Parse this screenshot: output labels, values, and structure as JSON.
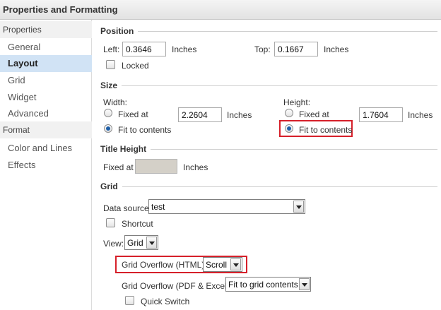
{
  "window": {
    "title": "Properties and Formatting"
  },
  "sidebar": {
    "groups": [
      {
        "label": "Properties"
      },
      {
        "label": "Format"
      }
    ],
    "items": [
      {
        "label": "General"
      },
      {
        "label": "Layout",
        "active": true
      },
      {
        "label": "Grid"
      },
      {
        "label": "Widget"
      },
      {
        "label": "Advanced"
      },
      {
        "label": "Color and Lines"
      },
      {
        "label": "Effects"
      }
    ]
  },
  "position": {
    "title": "Position",
    "left_label": "Left:",
    "left_value": "0.3646",
    "left_unit": "Inches",
    "top_label": "Top:",
    "top_value": "0.1667",
    "top_unit": "Inches",
    "locked_label": "Locked",
    "locked_checked": false
  },
  "size": {
    "title": "Size",
    "width_label": "Width:",
    "width_fixed_label": "Fixed at",
    "width_value": "2.2604",
    "width_unit": "Inches",
    "width_fit_label": "Fit to contents",
    "width_mode": "fit",
    "height_label": "Height:",
    "height_fixed_label": "Fixed at",
    "height_value": "1.7604",
    "height_unit": "Inches",
    "height_fit_label": "Fit to contents",
    "height_mode": "fit"
  },
  "title_height": {
    "title": "Title Height",
    "fixed_label": "Fixed at",
    "value": "",
    "unit": "Inches"
  },
  "grid": {
    "title": "Grid",
    "data_source_label": "Data source:",
    "data_source_value": "test",
    "shortcut_label": "Shortcut",
    "shortcut_checked": false,
    "view_label": "View:",
    "view_value": "Grid",
    "overflow_html_label": "Grid Overflow (HTML):",
    "overflow_html_value": "Scroll",
    "overflow_pdf_label": "Grid Overflow (PDF & Excel):",
    "overflow_pdf_value": "Fit to grid contents",
    "quick_switch_label": "Quick Switch",
    "quick_switch_checked": false
  },
  "colors": {
    "highlight": "#d6202a",
    "active_nav": "#d1e3f5",
    "radio_dot": "#1e5fa8"
  }
}
